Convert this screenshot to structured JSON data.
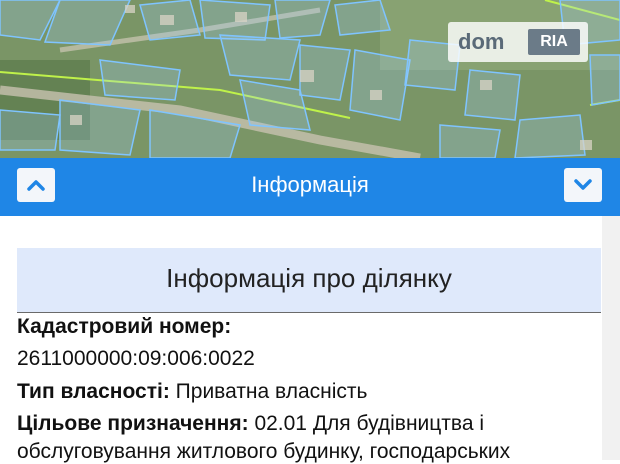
{
  "watermark": {
    "brand": "dom",
    "badge": "RIA"
  },
  "header": {
    "title": "Інформація",
    "collapse_icon": "chevron-up-icon",
    "expand_icon": "chevron-down-icon"
  },
  "colors": {
    "header": "#1f86e6",
    "section_bg": "#dfe9fb"
  },
  "parcel": {
    "section_title": "Інформація про ділянку",
    "cadastral_label": "Кадастровий номер:",
    "cadastral_value": "2611000000:09:006:0022",
    "ownership_label": "Тип власності:",
    "ownership_value": "Приватна власність",
    "purpose_label": "Цільове призначення:",
    "purpose_value_1": "02.01 Для будівництва і",
    "purpose_value_2": "обслуговування житлового будинку, господарських"
  }
}
